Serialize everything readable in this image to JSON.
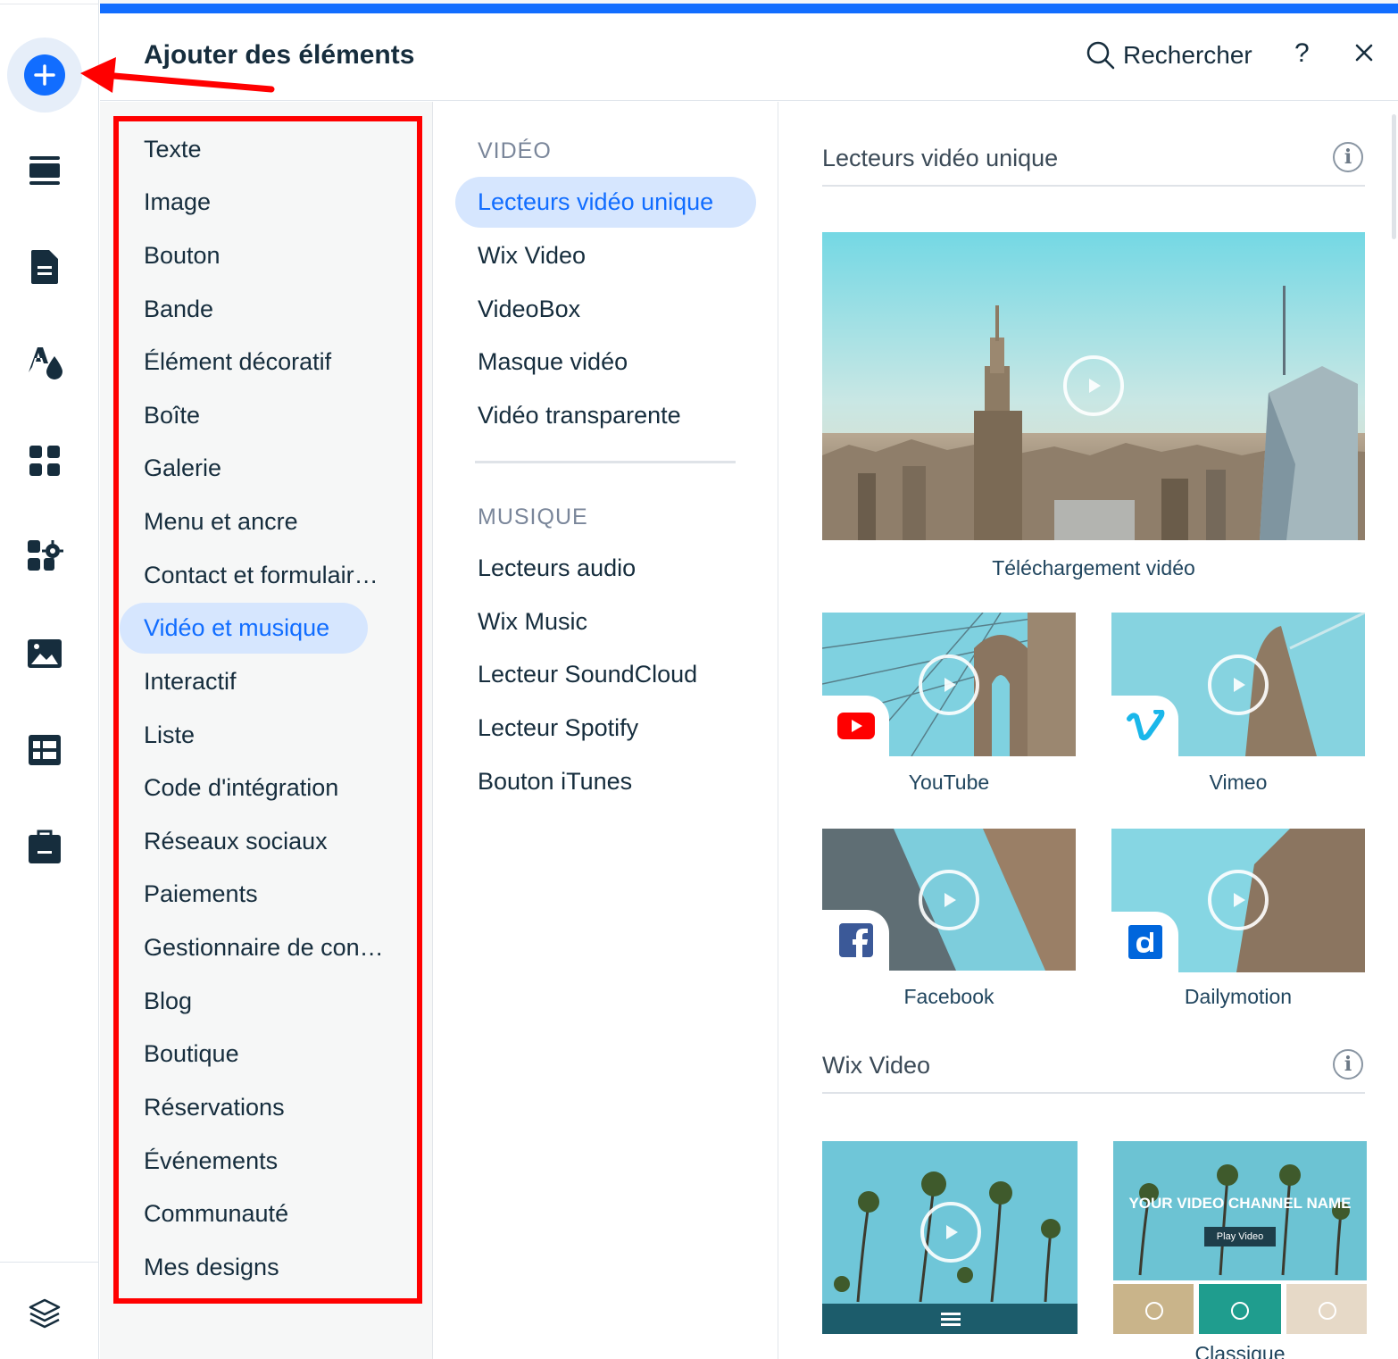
{
  "header": {
    "title": "Ajouter des éléments",
    "search_label": "Rechercher",
    "help_label": "?"
  },
  "rail": {
    "icons": [
      "add-icon",
      "sections-icon",
      "pages-icon",
      "theme-icon",
      "apps-icon",
      "app-market-icon",
      "media-icon",
      "cms-icon",
      "business-icon",
      "layers-icon"
    ]
  },
  "categories": {
    "items": [
      "Texte",
      "Image",
      "Bouton",
      "Bande",
      "Élément décoratif",
      "Boîte",
      "Galerie",
      "Menu et ancre",
      "Contact et formulair…",
      "Vidéo et musique",
      "Interactif",
      "Liste",
      "Code d'intégration",
      "Réseaux sociaux",
      "Paiements",
      "Gestionnaire de con…",
      "Blog",
      "Boutique",
      "Réservations",
      "Événements",
      "Communauté",
      "Mes designs"
    ],
    "selected": "Vidéo et musique"
  },
  "subcategories": {
    "video_heading": "VIDÉO",
    "video_items": [
      "Lecteurs vidéo unique",
      "Wix Video",
      "VideoBox",
      "Masque vidéo",
      "Vidéo transparente"
    ],
    "selected": "Lecteurs vidéo unique",
    "music_heading": "MUSIQUE",
    "music_items": [
      "Lecteurs audio",
      "Wix Music",
      "Lecteur SoundCloud",
      "Lecteur Spotify",
      "Bouton iTunes"
    ]
  },
  "content": {
    "section1_title": "Lecteurs vidéo unique",
    "upload_caption": "Téléchargement vidéo",
    "youtube_caption": "YouTube",
    "vimeo_caption": "Vimeo",
    "facebook_caption": "Facebook",
    "dailymotion_caption": "Dailymotion",
    "section2_title": "Wix Video",
    "channel_overlay_title": "YOUR VIDEO CHANNEL NAME",
    "channel_overlay_button": "Play Video",
    "classic_caption": "Classique"
  },
  "colors": {
    "accent": "#116dff",
    "selected_bg": "#d6e6fe",
    "annotation_red": "#ff0000"
  }
}
